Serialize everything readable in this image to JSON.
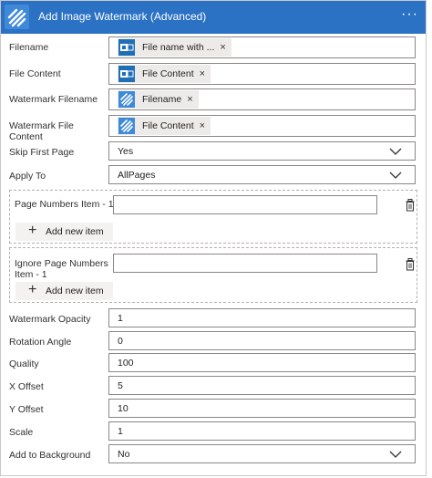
{
  "header": {
    "title": "Add Image Watermark (Advanced)",
    "more": "···",
    "color": "#2b72c4"
  },
  "fields": {
    "filename": {
      "label": "Filename",
      "token": "File name with ...",
      "token_icon": "outlook-icon"
    },
    "file_content": {
      "label": "File Content",
      "token": "File Content",
      "token_icon": "outlook-icon"
    },
    "watermark_filename": {
      "label": "Watermark Filename",
      "token": "Filename",
      "token_icon": "stripes-icon"
    },
    "watermark_file_content": {
      "label": "Watermark File Content",
      "token": "File Content",
      "token_icon": "stripes-icon"
    },
    "skip_first_page": {
      "label": "Skip First Page",
      "value": "Yes"
    },
    "apply_to": {
      "label": "Apply To",
      "value": "AllPages"
    },
    "page_numbers": {
      "label": "Page Numbers Item - 1",
      "value": "",
      "add_label": "Add new item"
    },
    "ignore_page_numbers": {
      "label": "Ignore Page Numbers Item - 1",
      "value": "",
      "add_label": "Add new item"
    },
    "watermark_opacity": {
      "label": "Watermark Opacity",
      "value": "1"
    },
    "rotation_angle": {
      "label": "Rotation Angle",
      "value": "0"
    },
    "quality": {
      "label": "Quality",
      "value": "100"
    },
    "x_offset": {
      "label": "X Offset",
      "value": "5"
    },
    "y_offset": {
      "label": "Y Offset",
      "value": "10"
    },
    "scale": {
      "label": "Scale",
      "value": "1"
    },
    "add_to_background": {
      "label": "Add to Background",
      "value": "No"
    }
  },
  "token_remove": "×"
}
